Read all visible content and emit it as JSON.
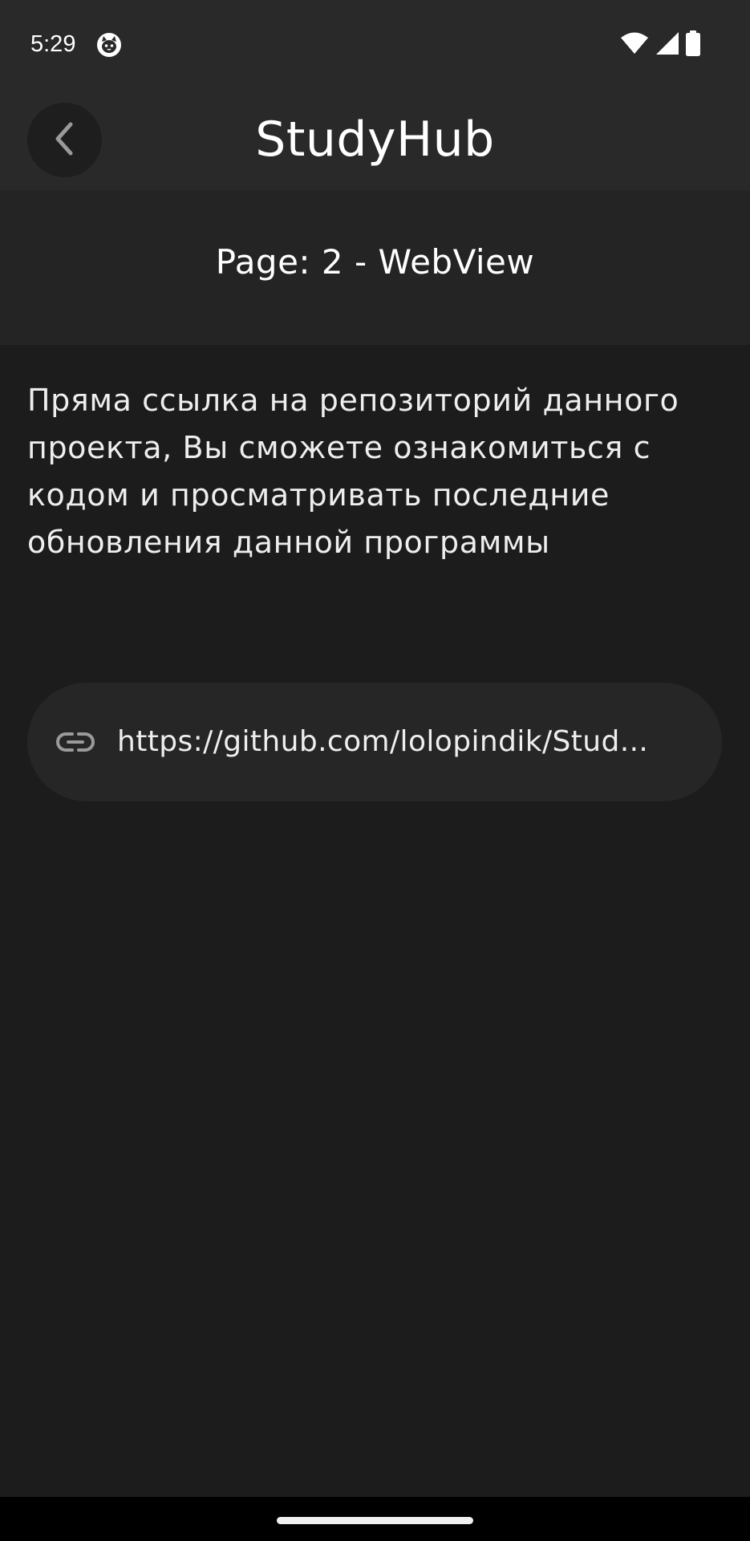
{
  "status_bar": {
    "time": "5:29",
    "app_icon": "cat-face-icon",
    "wifi_icon": "wifi-icon",
    "signal_icon": "cell-signal-icon",
    "battery_icon": "battery-icon"
  },
  "app_bar": {
    "title": "StudyHub",
    "back_icon": "chevron-left-icon"
  },
  "page": {
    "label": "Page: 2 - WebView"
  },
  "content": {
    "description": "Пряма ссылка на репозиторий данного проекта, Вы сможете ознакомиться с кодом и просматривать последние обновления данной программы",
    "link": {
      "icon": "link-icon",
      "url": "https://github.com/lolopindik/Stud..."
    }
  },
  "colors": {
    "background": "#1c1c1c",
    "app_bar": "#2a2929",
    "page_band": "#242424",
    "link_card": "#262626",
    "text": "#ffffff"
  }
}
